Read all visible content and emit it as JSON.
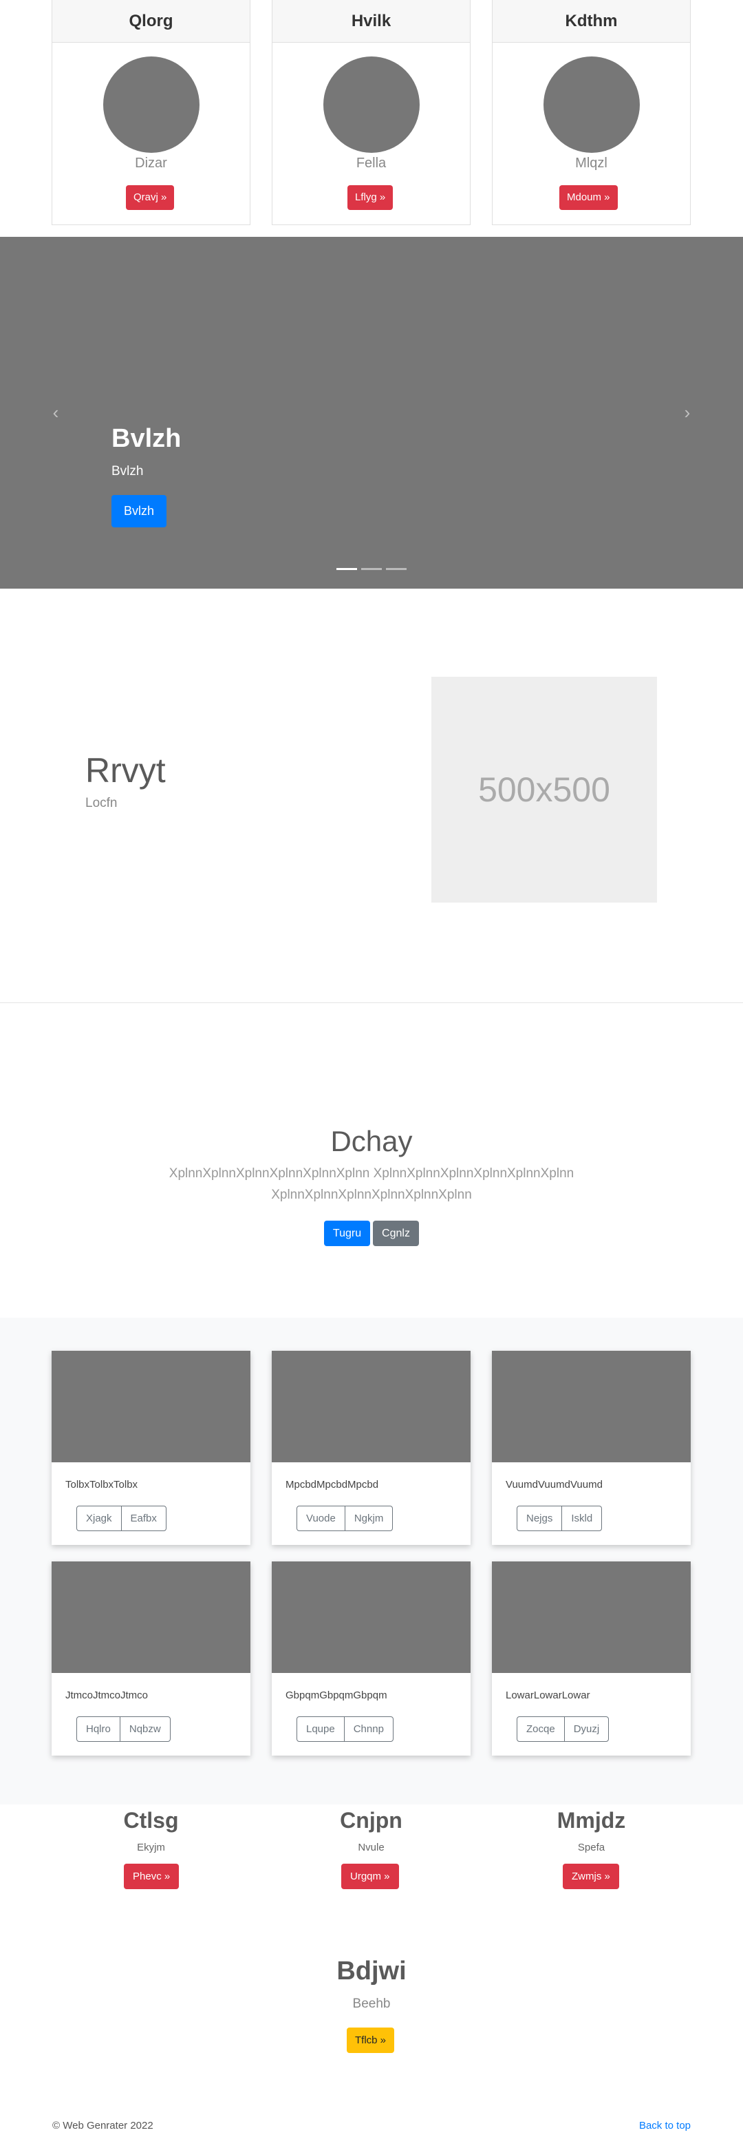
{
  "pricing": [
    {
      "title": "Qlorg",
      "name": "Dizar",
      "button": "Qravj »"
    },
    {
      "title": "Hvilk",
      "name": "Fella",
      "button": "Lflyg »"
    },
    {
      "title": "Kdthm",
      "name": "Mlqzl",
      "button": "Mdoum »"
    }
  ],
  "carousel": {
    "title": "Bvlzh",
    "subtitle": "Bvlzh",
    "button": "Bvlzh",
    "prev_icon": "‹",
    "next_icon": "›"
  },
  "feature": {
    "title": "Rrvyt",
    "subtitle": "Locfn",
    "placeholder": "500x500"
  },
  "jumbotron": {
    "title": "Dchay",
    "lead": "XplnnXplnnXplnnXplnnXplnnXplnn XplnnXplnnXplnnXplnnXplnnXplnn XplnnXplnnXplnnXplnnXplnnXplnn",
    "primary_button": "Tugru",
    "secondary_button": "Cgnlz"
  },
  "album": [
    {
      "text": "TolbxTolbxTolbx",
      "btn1": "Xjagk",
      "btn2": "Eafbx"
    },
    {
      "text": "MpcbdMpcbdMpcbd",
      "btn1": "Vuode",
      "btn2": "Ngkjm"
    },
    {
      "text": "VuumdVuumdVuumd",
      "btn1": "Nejgs",
      "btn2": "Iskld"
    },
    {
      "text": "JtmcoJtmcoJtmco",
      "btn1": "Hqlro",
      "btn2": "Nqbzw"
    },
    {
      "text": "GbpqmGbpqmGbpqm",
      "btn1": "Lqupe",
      "btn2": "Chnnp"
    },
    {
      "text": "LowarLowarLowar",
      "btn1": "Zocqe",
      "btn2": "Dyuzj"
    }
  ],
  "marketing": [
    {
      "title": "Ctlsg",
      "text": "Ekyjm",
      "button": "Phevc »"
    },
    {
      "title": "Cnjpn",
      "text": "Nvule",
      "button": "Urgqm »"
    },
    {
      "title": "Mmjdz",
      "text": "Spefa",
      "button": "Zwmjs »"
    }
  ],
  "cta": {
    "title": "Bdjwi",
    "subtitle": "Beehb",
    "button": "Tflcb »"
  },
  "footer": {
    "copyright": "© Web Genrater 2022",
    "back_to_top": "Back to top"
  },
  "colors": {
    "primary": "#007bff",
    "danger": "#dc3545",
    "secondary": "#6c757d",
    "warning": "#ffc107",
    "placeholder_gray": "#777777"
  }
}
